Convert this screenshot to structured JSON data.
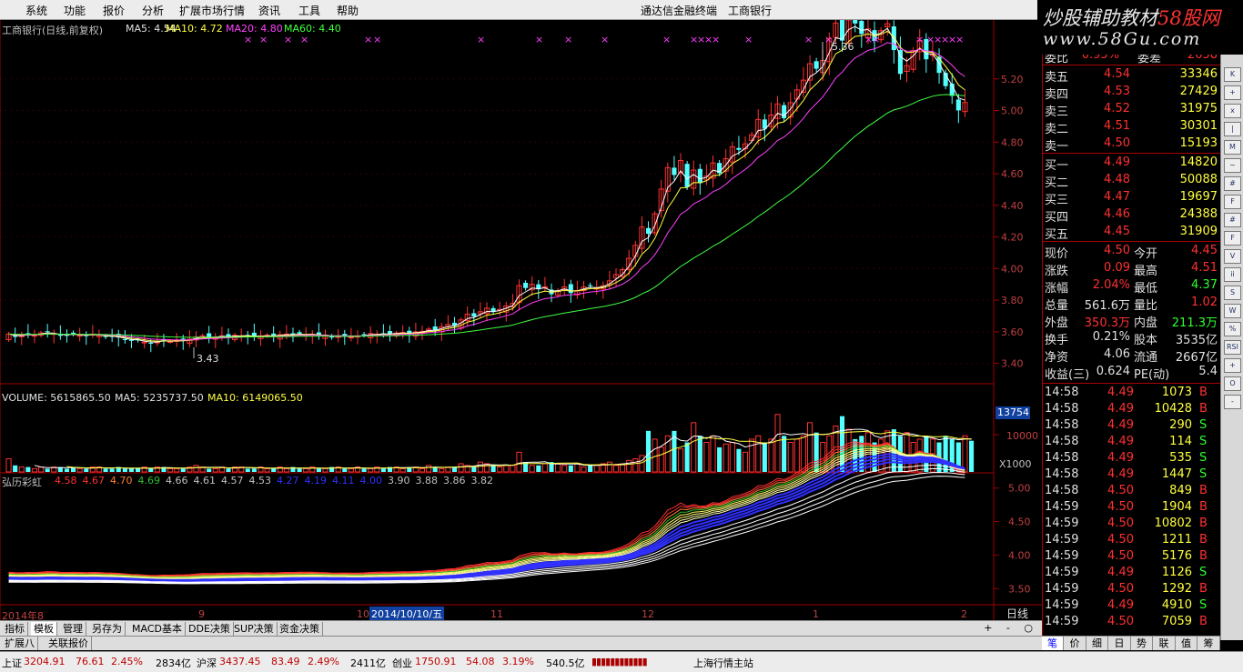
{
  "menu": {
    "items": [
      "系统",
      "功能",
      "报价",
      "分析",
      "扩展市场行情",
      "资讯",
      "工具",
      "帮助"
    ],
    "center_app": "通达信金融终端",
    "center_stock": "工商银行"
  },
  "watermark": {
    "line1_a": "炒股辅助教材",
    "line1_b": "58股网",
    "line2": "www.58Gu.com"
  },
  "main_header": {
    "title": "工商银行(日线,前复权)",
    "ma5": "MA5: 4.54",
    "ma10": "MA10: 4.72",
    "ma20": "MA20: 4.80",
    "ma60": "MA60: 4.40"
  },
  "price_axis": [
    "5.20",
    "5.00",
    "4.80",
    "4.60",
    "4.40",
    "4.20",
    "4.00",
    "3.80",
    "3.60",
    "3.40"
  ],
  "annotations": {
    "high": "5.36",
    "low": "3.43"
  },
  "volume_header": {
    "label": "VOLUME: 5615865.50",
    "ma5": "MA5: 5235737.50",
    "ma10": "MA10: 6149065.50"
  },
  "volume_axis": {
    "top": "13754",
    "mid": "10000",
    "unit": "X1000"
  },
  "indicator_header": {
    "name": "弘历彩虹",
    "vals": [
      "4.58",
      "4.67",
      "4.70",
      "4.69",
      "4.66",
      "4.61",
      "4.57",
      "4.53",
      "4.27",
      "4.19",
      "4.11",
      "4.00",
      "3.90",
      "3.88",
      "3.86",
      "3.82"
    ],
    "colors": [
      "#ff3030",
      "#ff3030",
      "#ff8030",
      "#30c030",
      "#c0c0c0",
      "#c0c0c0",
      "#c0c0c0",
      "#c0c0c0",
      "#3030ff",
      "#3030ff",
      "#3030ff",
      "#3030ff",
      "#c0c0c0",
      "#c0c0c0",
      "#c0c0c0",
      "#c0c0c0"
    ]
  },
  "indicator_axis": [
    "5.00",
    "4.50",
    "4.00",
    "3.50"
  ],
  "date_axis": {
    "d0": "2014年8",
    "d1": "9",
    "d2": "10",
    "cursor": "2014/10/10/五",
    "d3": "11",
    "d4": "12",
    "d5": "1",
    "d6": "2",
    "period": "日线"
  },
  "tabs1": [
    "指标",
    "模板",
    "管理",
    "另存为",
    "MACD基本",
    "DDE决策",
    "SUP决策",
    "资金决策"
  ],
  "tabs1_active": 1,
  "tabs2": [
    "扩展八",
    "关联报价"
  ],
  "right_tabs": [
    "笔",
    "价",
    "细",
    "日",
    "势",
    "联",
    "值",
    "筹"
  ],
  "quote": {
    "header": {
      "label": "委比",
      "value": "0.95%",
      "label2": "委差",
      "value2": "2658"
    },
    "sells": [
      [
        "卖五",
        "4.54",
        "33346"
      ],
      [
        "卖四",
        "4.53",
        "27429"
      ],
      [
        "卖三",
        "4.52",
        "31975"
      ],
      [
        "卖二",
        "4.51",
        "30301"
      ],
      [
        "卖一",
        "4.50",
        "15193"
      ]
    ],
    "buys": [
      [
        "买一",
        "4.49",
        "14820"
      ],
      [
        "买二",
        "4.48",
        "50088"
      ],
      [
        "买三",
        "4.47",
        "19697"
      ],
      [
        "买四",
        "4.46",
        "24388"
      ],
      [
        "买五",
        "4.45",
        "31909"
      ]
    ],
    "stats": [
      [
        "现价",
        "4.50",
        "今开",
        "4.45",
        "#ff3030",
        "#ff3030"
      ],
      [
        "涨跌",
        "0.09",
        "最高",
        "4.51",
        "#ff3030",
        "#ff3030"
      ],
      [
        "涨幅",
        "2.04%",
        "最低",
        "4.37",
        "#ff3030",
        "#30ff30"
      ],
      [
        "总量",
        "561.6万",
        "量比",
        "1.02",
        "#e0e0e0",
        "#ff3030"
      ],
      [
        "外盘",
        "350.3万",
        "内盘",
        "211.3万",
        "#ff3030",
        "#30ff30"
      ],
      [
        "换手",
        "0.21%",
        "股本",
        "3535亿",
        "#e0e0e0",
        "#e0e0e0"
      ],
      [
        "净资",
        "4.06",
        "流通",
        "2667亿",
        "#e0e0e0",
        "#e0e0e0"
      ],
      [
        "收益(三)",
        "0.624",
        "PE(动)",
        "5.4",
        "#e0e0e0",
        "#e0e0e0"
      ]
    ],
    "ticks": [
      [
        "14:58",
        "4.49",
        "1073",
        "B"
      ],
      [
        "14:58",
        "4.49",
        "10428",
        "B"
      ],
      [
        "14:58",
        "4.49",
        "290",
        "S"
      ],
      [
        "14:58",
        "4.49",
        "114",
        "S"
      ],
      [
        "14:58",
        "4.49",
        "535",
        "S"
      ],
      [
        "14:58",
        "4.49",
        "1447",
        "S"
      ],
      [
        "14:58",
        "4.50",
        "849",
        "B"
      ],
      [
        "14:59",
        "4.50",
        "1904",
        "B"
      ],
      [
        "14:59",
        "4.50",
        "10802",
        "B"
      ],
      [
        "14:59",
        "4.50",
        "1211",
        "B"
      ],
      [
        "14:59",
        "4.50",
        "5176",
        "B"
      ],
      [
        "14:59",
        "4.49",
        "1126",
        "S"
      ],
      [
        "14:59",
        "4.50",
        "1292",
        "B"
      ],
      [
        "14:59",
        "4.49",
        "4910",
        "S"
      ],
      [
        "14:59",
        "4.50",
        "7059",
        "B"
      ]
    ]
  },
  "status": {
    "sh_label": "上证",
    "sh_val": "3204.91",
    "sh_chg": "76.61",
    "sh_pct": "2.45%",
    "sh_amt": "2834亿",
    "sz_label": "沪深",
    "sz_val": "3437.45",
    "sz_chg": "83.49",
    "sz_pct": "2.49%",
    "sz_amt": "2411亿",
    "cy_label": "创业",
    "cy_val": "1750.91",
    "cy_chg": "54.08",
    "cy_pct": "3.19%",
    "cy_amt": "540.5亿",
    "server": "上海行情主站"
  },
  "toolstrip": [
    "K",
    "+",
    "x",
    "|",
    "M",
    "~",
    "#",
    "F",
    "#",
    "F",
    "V",
    "ii",
    "S",
    "W",
    "%",
    "RSI",
    "+",
    "O",
    "-"
  ],
  "chart_data": {
    "type": "candlestick",
    "title": "工商银行(日线,前复权)",
    "ylim": [
      3.3,
      5.4
    ],
    "start_price": 3.55,
    "returns": [
      0.01,
      -0.005,
      0.002,
      0.003,
      -0.002,
      0.004,
      0.002,
      -0.003,
      -0.004,
      0.001,
      0.002,
      -0.002,
      -0.001,
      0.003,
      -0.002,
      -0.003,
      0.001,
      -0.002,
      -0.004,
      -0.002,
      0.001,
      -0.003,
      -0.002,
      0.002,
      0.004,
      -0.003,
      0.002,
      -0.001,
      0.003,
      0.004,
      0.002,
      -0.003,
      0.001,
      0.002,
      -0.002,
      0.003,
      -0.001,
      0.001,
      -0.003,
      0.002,
      0.001,
      -0.002,
      0.003,
      0.001,
      -0.001,
      0.002,
      -0.002,
      0.001,
      -0.003,
      0.001,
      -0.004,
      0.002,
      0.001,
      -0.002,
      0.002,
      0.001,
      0.003,
      -0.001,
      0.001,
      -0.001,
      0.002,
      0.001,
      -0.002,
      0.003,
      0.001,
      0.004,
      -0.002,
      0.006,
      0.004,
      -0.002,
      0.01,
      0.01,
      -0.004,
      0.008,
      0.006,
      -0.006,
      0.004,
      0.006,
      0.004,
      0.03,
      -0.004,
      0.006,
      -0.008,
      0.004,
      -0.012,
      0.006,
      0.006,
      -0.01,
      0.004,
      0.006,
      0.002,
      -0.004,
      0.004,
      0.008,
      0.01,
      0.008,
      0.018,
      0.02,
      0.028,
      -0.01,
      0.03,
      0.036,
      0.03,
      -0.01,
      0.02,
      -0.036,
      0.024,
      -0.018,
      0.01,
      0.018,
      -0.014,
      0.02,
      0.016,
      -0.004,
      0.008,
      0.012,
      0.02,
      -0.012,
      0.018,
      0.014,
      -0.018,
      0.02,
      0.016,
      0.012,
      0.02,
      -0.006,
      0.01,
      0.026,
      0.018,
      -0.02,
      0.024,
      -0.004,
      -0.012,
      0.006,
      -0.014,
      0.012,
      0.008,
      -0.03,
      -0.028,
      0.01,
      0.018,
      0.012,
      -0.022,
      0.006,
      -0.022,
      -0.016,
      -0.012,
      -0.018,
      0.01
    ],
    "vol_base": [
      8,
      4,
      3,
      3,
      2,
      3,
      2,
      3,
      3,
      2,
      3,
      2,
      2,
      3,
      3,
      2,
      2,
      3,
      2,
      2,
      2,
      3,
      2,
      3,
      3,
      2,
      2,
      2,
      3,
      4,
      3,
      2,
      2,
      3,
      2,
      3,
      3,
      2,
      2,
      3,
      2,
      2,
      3,
      2,
      3,
      2,
      2,
      3,
      2,
      2,
      3,
      3,
      2,
      2,
      3,
      2,
      2,
      3,
      2,
      3,
      3,
      2,
      3,
      3,
      2,
      4,
      3,
      2,
      3,
      3,
      5,
      4,
      3,
      6,
      5,
      4,
      3,
      4,
      4,
      12,
      6,
      4,
      4,
      5,
      6,
      5,
      4,
      4,
      5,
      3,
      4,
      4,
      5,
      6,
      4,
      5,
      7,
      8,
      10,
      25,
      20,
      15,
      22,
      25,
      14,
      18,
      30,
      22,
      18,
      22,
      15,
      17,
      18,
      14,
      12,
      20,
      22,
      18,
      20,
      35,
      22,
      18,
      20,
      22,
      30,
      24,
      18,
      22,
      28,
      34,
      26,
      20,
      22,
      24,
      18,
      20,
      25,
      26,
      22,
      24,
      18,
      20,
      22,
      20,
      18,
      22,
      20,
      18,
      22,
      19
    ]
  }
}
